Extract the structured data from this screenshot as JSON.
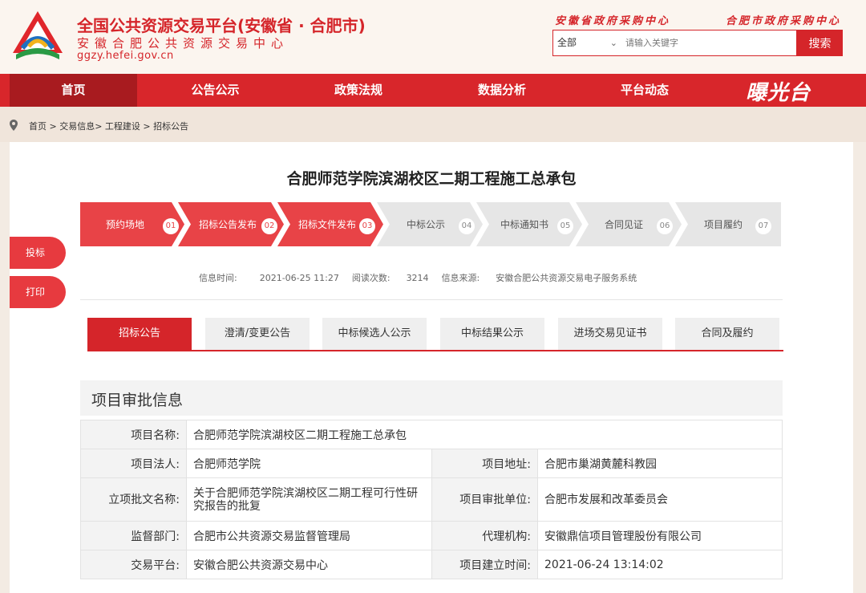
{
  "header": {
    "title": "全国公共资源交易平台(安徽省 · 合肥市)",
    "subtitle": "安徽合肥公共资源交易中心",
    "domain": "ggzy.hefei.gov.cn",
    "link1": "安徽省政府采购中心",
    "link2": "合肥市政府采购中心",
    "search": {
      "select_value": "全部",
      "placeholder": "请输入关键字",
      "button": "搜索"
    }
  },
  "nav": {
    "items": [
      "首页",
      "公告公示",
      "政策法规",
      "数据分析",
      "平台动态"
    ],
    "active_index": 0,
    "slogan": "曝光台"
  },
  "breadcrumb": "首页 > 交易信息> 工程建设 > 招标公告",
  "side": {
    "favorite": "投标",
    "print": "打印"
  },
  "page_title": "合肥师范学院滨湖校区二期工程施工总承包",
  "steps": [
    {
      "label": "预约场地",
      "num": "01",
      "active": true
    },
    {
      "label": "招标公告发布",
      "num": "02",
      "active": true
    },
    {
      "label": "招标文件发布",
      "num": "03",
      "active": true
    },
    {
      "label": "中标公示",
      "num": "04",
      "active": false
    },
    {
      "label": "中标通知书",
      "num": "05",
      "active": false
    },
    {
      "label": "合同见证",
      "num": "06",
      "active": false
    },
    {
      "label": "项目履约",
      "num": "07",
      "active": false
    }
  ],
  "meta": {
    "time_label": "信息时间:",
    "time": "2021-06-25 11:27",
    "views_label": "阅读次数:",
    "views": "3214",
    "source_label": "信息来源:",
    "source": "安徽合肥公共资源交易电子服务系统"
  },
  "tabs": [
    "招标公告",
    "澄清/变更公告",
    "中标候选人公示",
    "中标结果公示",
    "进场交易见证书",
    "合同及履约"
  ],
  "section_title": "项目审批信息",
  "info": {
    "name_label": "项目名称:",
    "name": "合肥师范学院滨湖校区二期工程施工总承包",
    "legal_label": "项目法人:",
    "legal": "合肥师范学院",
    "addr_label": "项目地址:",
    "addr": "合肥市巢湖黄麓科教园",
    "approval_doc_label": "立项批文名称:",
    "approval_doc": "关于合肥师范学院滨湖校区二期工程可行性研究报告的批复",
    "approval_unit_label": "项目审批单位:",
    "approval_unit": "合肥市发展和改革委员会",
    "supervisor_label": "监督部门:",
    "supervisor": "合肥市公共资源交易监督管理局",
    "agent_label": "代理机构:",
    "agent": "安徽鼎信项目管理股份有限公司",
    "platform_label": "交易平台:",
    "platform": "安徽合肥公共资源交易中心",
    "created_label": "项目建立时间:",
    "created": "2021-06-24 13:14:02"
  },
  "colors": {
    "brand_red": "#d5252a",
    "nav_active": "#a81b1f",
    "step_on": "#e84347",
    "step_off": "#e6e6e6"
  }
}
